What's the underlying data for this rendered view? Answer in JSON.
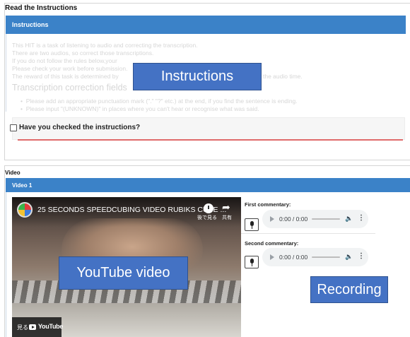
{
  "instructions_section": {
    "title": "Read the Instructions",
    "header": "Instructions",
    "lines": [
      "This HIT is a task of listening to audio and correcting the transcription.",
      "There are two audios, so correct those transcriptions.",
      "If you do not follow the rules below,your",
      "Please check your work before submission.",
      "The reward of this task is determined by",
      "the audio time."
    ],
    "fields_heading": "Transcription correction fields",
    "bullets": [
      "Please add an appropriate punctuation mark (\".\" \"?\" etc.) at the end, if you find the sentence is ending.",
      "Please input \"(UNKNOWN)\" in places where you can't hear or recognise what was said."
    ],
    "checkbox_label": "Have you checked the instructions?",
    "callout": "Instructions"
  },
  "video_section": {
    "title": "Video",
    "header": "Video 1",
    "youtube": {
      "title": "25 SECONDS SPEEDCUBING VIDEO RUBIKS CUBE ...",
      "watch_later": "後で見る",
      "share": "共有",
      "watch_on": "見る",
      "logo_text": "YouTube",
      "callout": "YouTube video"
    },
    "recording": {
      "first_label": "First commentary:",
      "second_label": "Second commentary:",
      "first_time": "0:00 / 0:00",
      "second_time": "0:00 / 0:00",
      "callout": "Recording"
    }
  },
  "colors": {
    "header_blue": "#3b82c8",
    "callout_blue": "#4472c4",
    "error_line": "#e06a6a"
  },
  "icons": [
    "checkbox-icon",
    "play-icon",
    "volume-icon",
    "more-icon",
    "microphone-icon",
    "watch-later-icon",
    "share-icon",
    "youtube-logo-icon"
  ]
}
